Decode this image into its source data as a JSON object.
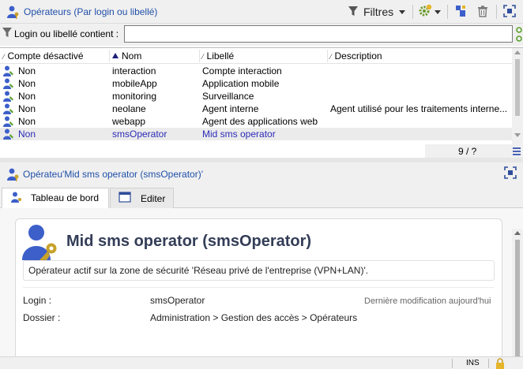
{
  "colors": {
    "title_blue": "#1f4fa8",
    "selected_text": "#2a2ab8",
    "key_gold": "#c8a22a",
    "avatar_blue": "#3c5fc9",
    "filter_green": "#5aa02c"
  },
  "list_panel": {
    "title": "Opérateurs (Par login ou libellé)",
    "icon": "operator-icon",
    "toolbar": {
      "filters_label": "Filtres",
      "filters_icon": "funnel-icon",
      "actions_icon": "gear-add-icon",
      "new_icon": "new-item-icon",
      "delete_icon": "trash-icon",
      "maximize_icon": "maximize-icon"
    }
  },
  "filter": {
    "label": "Login ou libellé contient :",
    "value": "",
    "icon": "funnel-icon"
  },
  "table": {
    "columns": [
      {
        "label": "Compte désactivé",
        "sort": "none"
      },
      {
        "label": "Nom",
        "sort": "asc"
      },
      {
        "label": "Libellé",
        "sort": "none"
      },
      {
        "label": "Description",
        "sort": "none"
      }
    ],
    "rows": [
      {
        "disabled": "Non",
        "name": "interaction",
        "label": "Compte interaction",
        "description": ""
      },
      {
        "disabled": "Non",
        "name": "mobileApp",
        "label": "Application mobile",
        "description": ""
      },
      {
        "disabled": "Non",
        "name": "monitoring",
        "label": "Surveillance",
        "description": ""
      },
      {
        "disabled": "Non",
        "name": "neolane",
        "label": "Agent interne",
        "description": "Agent utilisé pour les traitements interne..."
      },
      {
        "disabled": "Non",
        "name": "webapp",
        "label": "Agent des applications web",
        "description": ""
      },
      {
        "disabled": "Non",
        "name": "smsOperator",
        "label": "Mid sms operator",
        "description": "",
        "selected": true
      }
    ],
    "count": "9 / ?"
  },
  "detail_panel": {
    "title": "Opérateu'Mid sms operator (smsOperator)'",
    "tabs": [
      {
        "label": "Tableau de bord",
        "icon": "operator-icon",
        "active": true
      },
      {
        "label": "Editer",
        "icon": "edit-form-icon",
        "active": false
      }
    ],
    "card": {
      "name": "Mid sms operator (smsOperator)",
      "description": "Opérateur actif sur la zone de sécurité 'Réseau privé de l'entreprise (VPN+LAN)'.",
      "login_label": "Login :",
      "login_value": "smsOperator",
      "last_modified": "Dernière modification aujourd'hui",
      "folder_label": "Dossier :",
      "folder_value": "Administration > Gestion des accès > Opérateurs"
    }
  },
  "statusbar": {
    "mode": "INS",
    "lock_icon": "lock-icon"
  }
}
